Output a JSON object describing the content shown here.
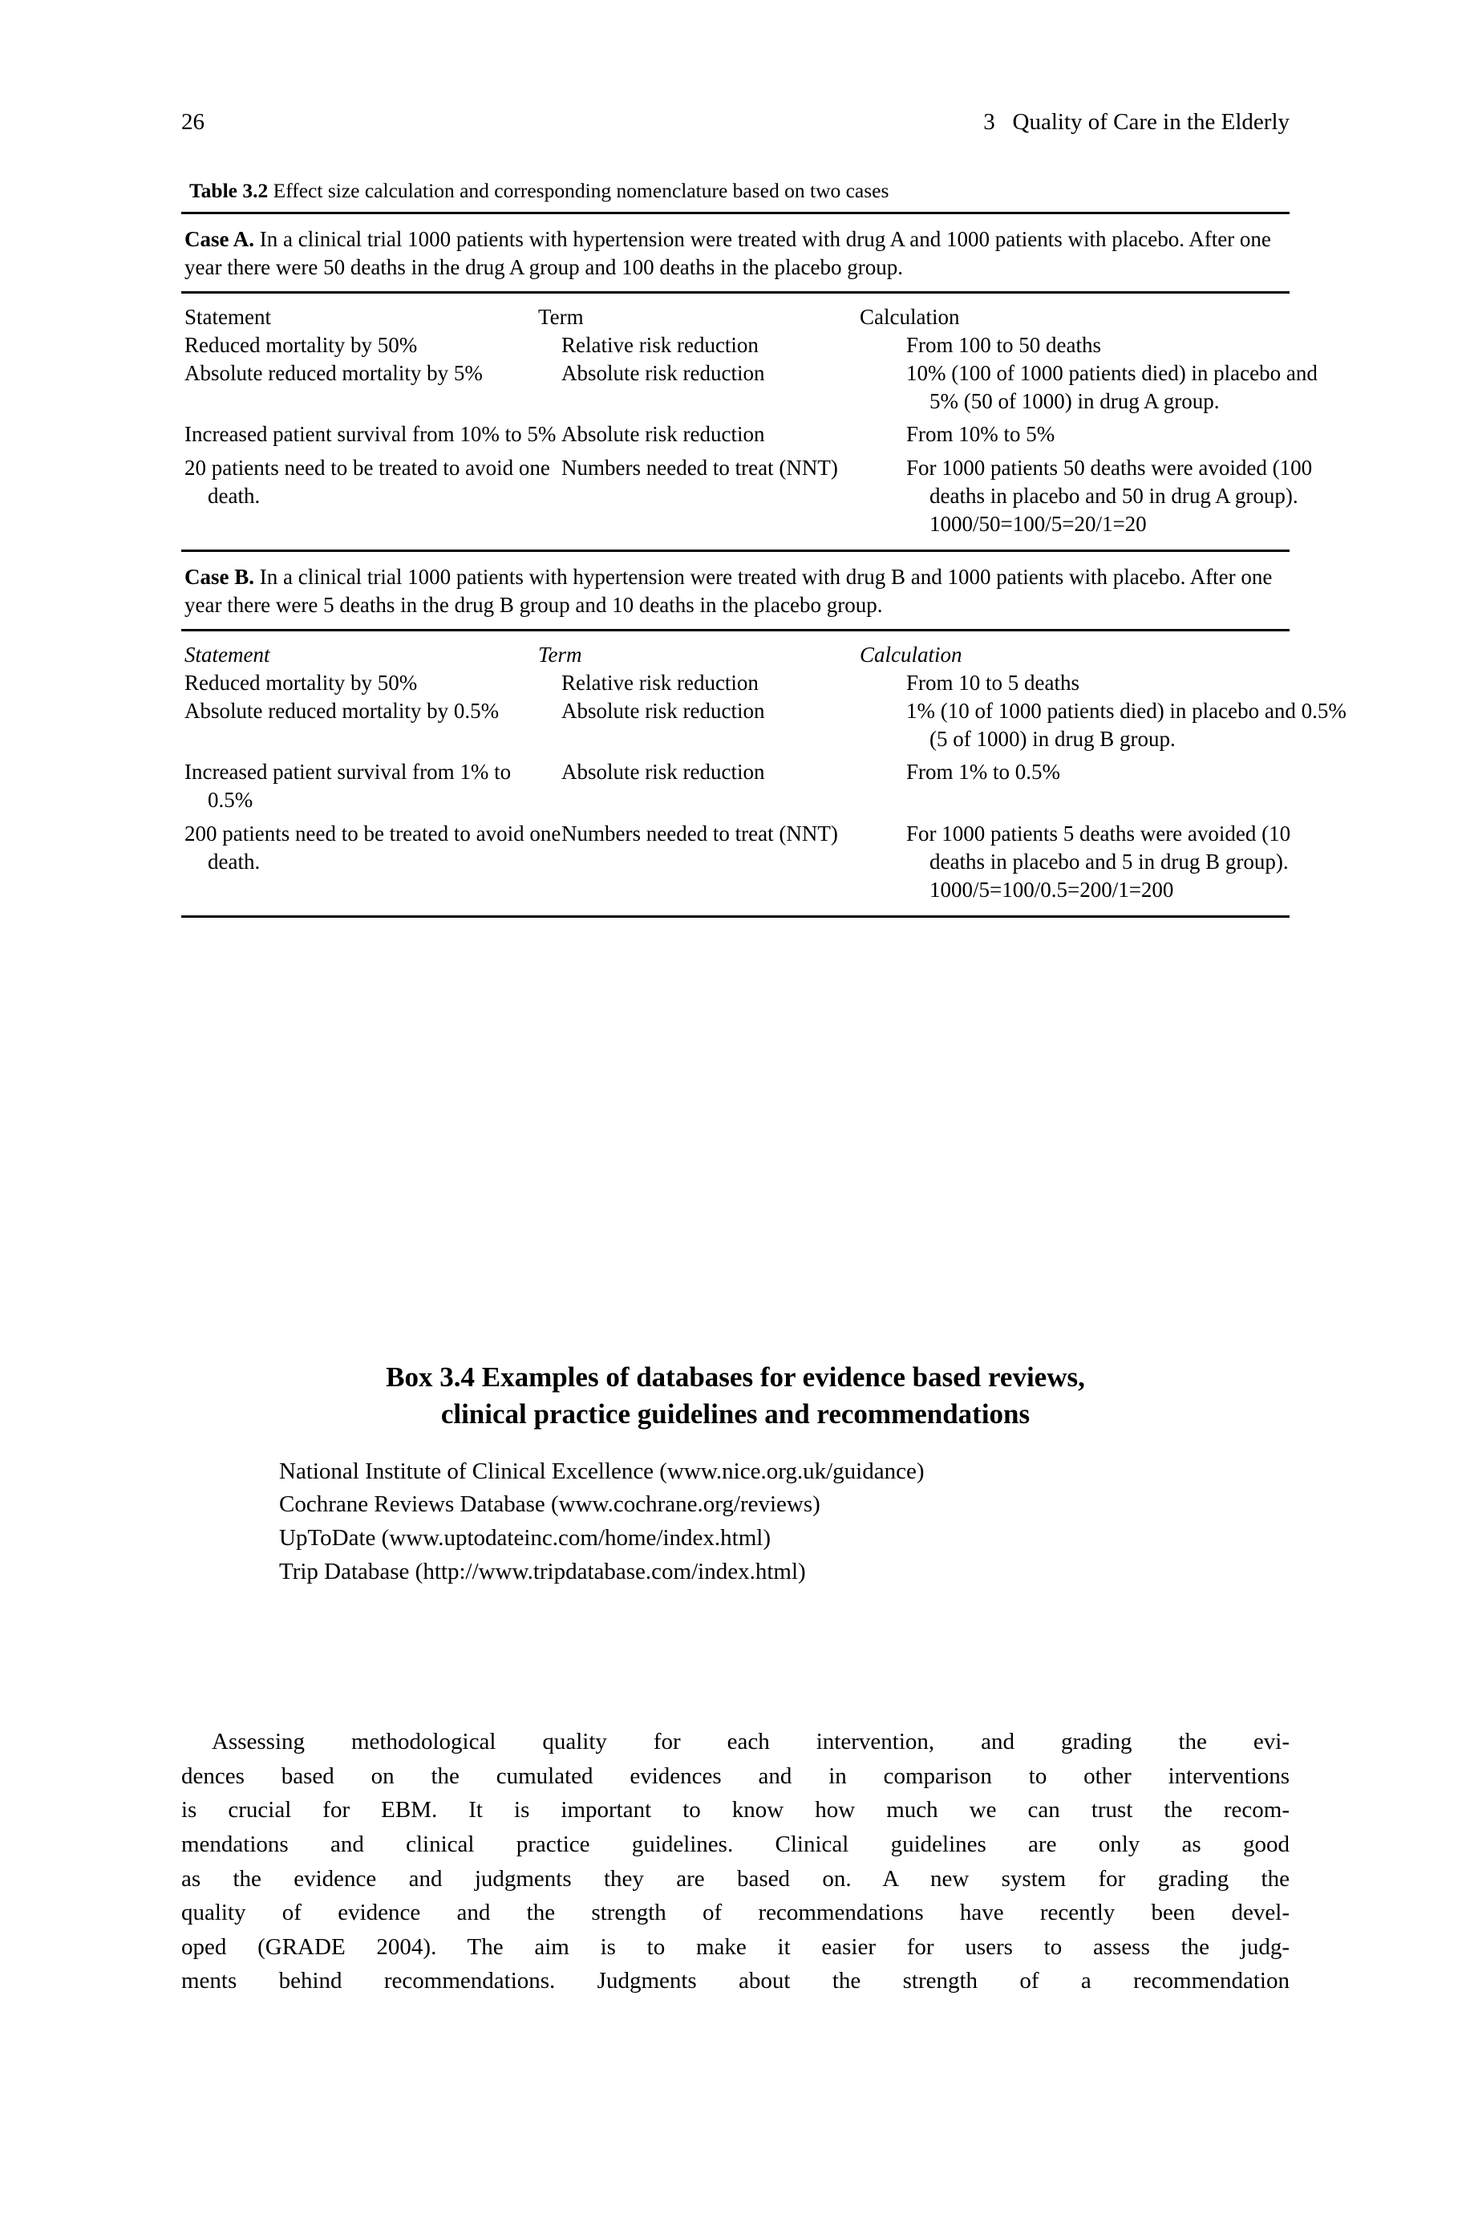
{
  "running_head": {
    "folio": "26",
    "chapter_number": "3",
    "chapter_title": "Quality of Care in the Elderly"
  },
  "table": {
    "caption_label": "Table 3.2",
    "caption_text": "Effect size calculation and corresponding nomenclature based on two cases",
    "cases": [
      {
        "name": "Case A.",
        "description": "In a clinical trial 1000 patients with hypertension were treated with drug A and 1000 patients with placebo. After one year there were 50 deaths in the drug A group and 100 deaths in the placebo group.",
        "headers": {
          "statement": "Statement",
          "term": "Term",
          "calculation": "Calculation"
        },
        "header_italic": false,
        "rows": [
          {
            "statement": "Reduced mortality by 50%",
            "term": "Relative risk reduction",
            "calculation": "From 100 to 50 deaths"
          },
          {
            "statement": "Absolute reduced mortality by 5%",
            "term": "Absolute risk reduction",
            "calculation": "10% (100 of 1000 patients died) in placebo and 5% (50 of 1000) in drug A group."
          },
          {
            "statement": "Increased patient survival from 10% to 5%",
            "term": "Absolute risk reduction",
            "calculation": "From 10% to 5%"
          },
          {
            "statement": "20 patients need to be treated to avoid one death.",
            "term": "Numbers needed to treat (NNT)",
            "calculation": "For 1000 patients 50 deaths were avoided (100 deaths in placebo and 50 in drug A group). 1000/50=100/5=20/1=20"
          }
        ]
      },
      {
        "name": "Case B.",
        "description": "In a clinical trial 1000 patients with hypertension were treated with drug B and 1000 patients with placebo. After one year there were 5 deaths in the drug B group and 10 deaths in the placebo group.",
        "headers": {
          "statement": "Statement",
          "term": "Term",
          "calculation": "Calculation"
        },
        "header_italic": true,
        "rows": [
          {
            "statement": "Reduced mortality by 50%",
            "term": "Relative risk reduction",
            "calculation": "From 10 to 5 deaths"
          },
          {
            "statement": "Absolute reduced mortality by 0.5%",
            "term": "Absolute risk reduction",
            "calculation": "1% (10 of 1000 patients died) in placebo and 0.5% (5 of 1000) in drug B group."
          },
          {
            "statement": "Increased patient survival from 1% to 0.5%",
            "term": "Absolute risk reduction",
            "calculation": "From 1% to 0.5%"
          },
          {
            "statement": "200 patients need to be treated to avoid one death.",
            "term": "Numbers needed to treat (NNT)",
            "calculation": "For 1000 patients 5 deaths were avoided (10 deaths in placebo and 5 in drug B group). 1000/5=100/0.5=200/1=200"
          }
        ]
      }
    ]
  },
  "box": {
    "title_line_1": "Box 3.4 Examples of databases for evidence based reviews,",
    "title_line_2": "clinical practice guidelines and recommendations",
    "items": [
      "National Institute of Clinical Excellence (www.nice.org.uk/guidance)",
      "Cochrane Reviews Database (www.cochrane.org/reviews)",
      "UpToDate (www.uptodateinc.com/home/index.html)",
      "Trip Database (http://www.tripdatabase.com/index.html)"
    ]
  },
  "body_paragraph": {
    "lines": [
      "Assessing methodological quality for each intervention, and grading the evi-",
      "dences based on the cumulated evidences and in comparison to other interventions",
      "is crucial for EBM. It is important to know how much we can trust the recom-",
      "mendations and clinical practice guidelines. Clinical guidelines are only as good",
      "as the evidence and judgments they are based on. A new system for grading the",
      "quality of evidence and the strength of recommendations have recently been devel-",
      "oped (GRADE 2004). The aim is to make it easier for users to assess the judg-",
      "ments behind recommendations. Judgments about the strength of a recommendation"
    ]
  }
}
